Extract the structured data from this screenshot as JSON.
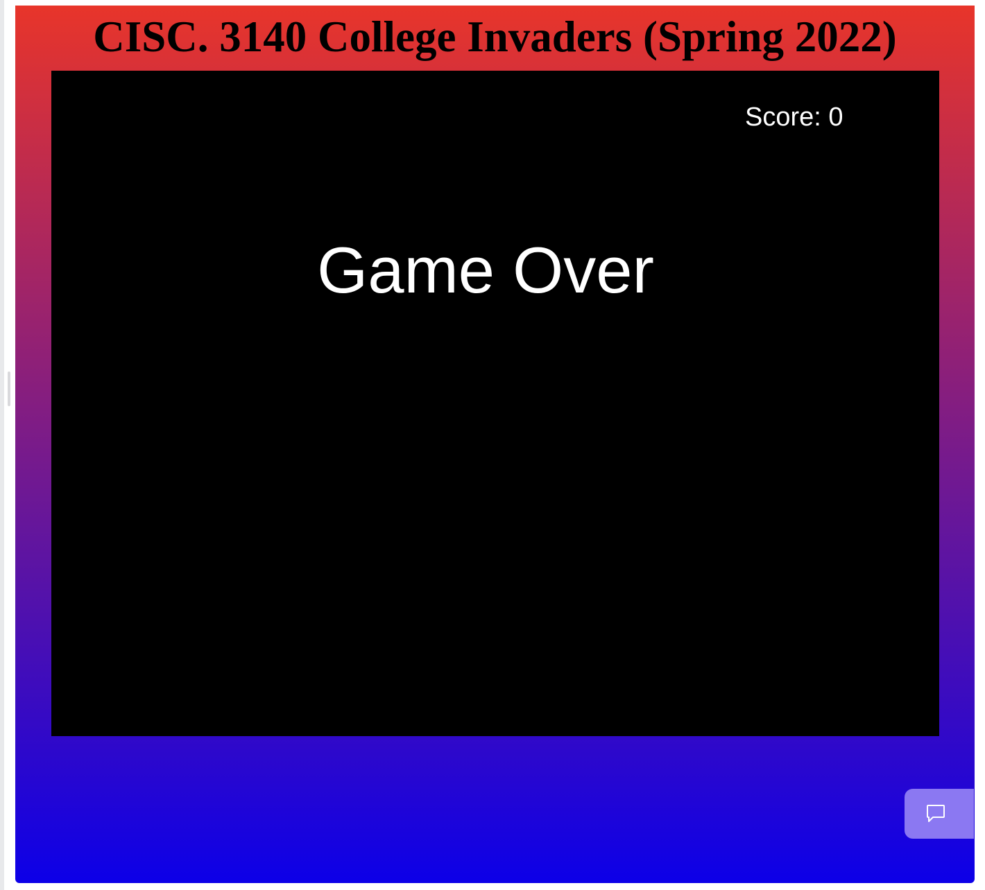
{
  "app": {
    "title": "CISC. 3140 College Invaders (Spring 2022)"
  },
  "game": {
    "score_text": "Score: 0",
    "status_text": "Game Over"
  },
  "chat": {
    "icon": "chat-bubble-icon"
  },
  "colors": {
    "gradient_top": "#e8352a",
    "gradient_mid": "#7e1c86",
    "gradient_bottom": "#0c00e8",
    "canvas_bg": "#000000",
    "chat_button": "#8b78f2",
    "text_on_canvas": "#ffffff"
  }
}
